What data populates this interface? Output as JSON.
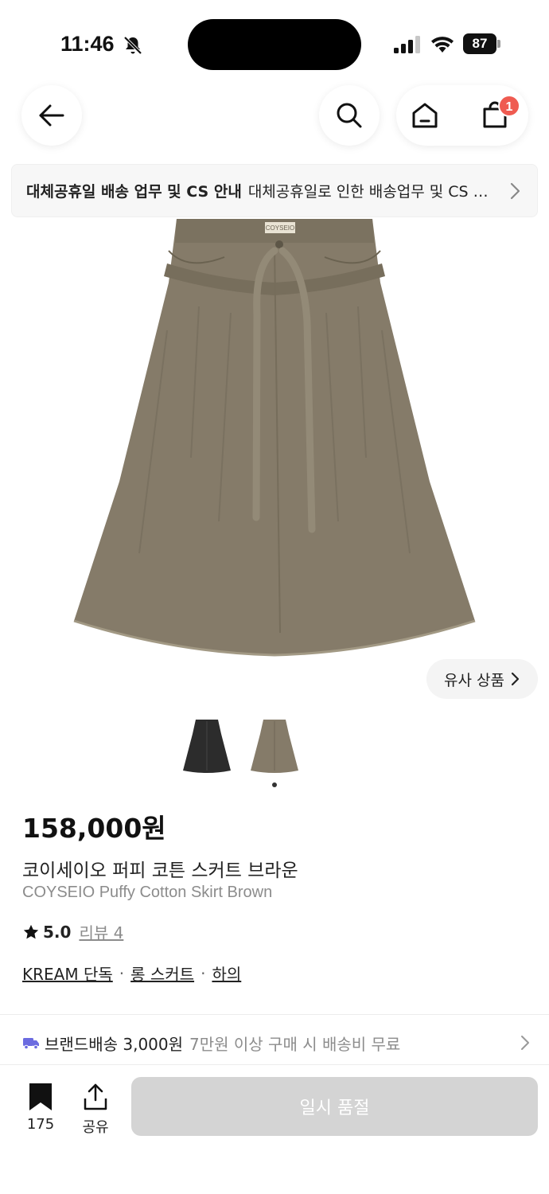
{
  "status_bar": {
    "time": "11:46",
    "battery": "87"
  },
  "notice": {
    "title": "대체공휴일 배송 업무 및 CS 안내",
    "text": "대체공휴일로 인한 배송업무 및 CS 운영 안내"
  },
  "nav": {
    "cart_count": "1"
  },
  "gallery": {
    "similar_label": "유사 상품",
    "thumbnails": [
      "black-skirt",
      "brown-skirt"
    ]
  },
  "product": {
    "price": "158,000원",
    "name_ko": "코이세이오 퍼피 코튼 스커트 브라운",
    "name_en": "COYSEIO Puffy Cotton Skirt Brown",
    "rating": "5.0",
    "review_label": "리뷰 4",
    "tags": [
      "KREAM 단독",
      "롱 스커트",
      "하의"
    ],
    "label_tag": "COYSEIO",
    "color": "#857b69"
  },
  "shipping": {
    "label": "브랜드배송 3,000원",
    "note": "7만원 이상 구매 시 배송비 무료"
  },
  "bottom": {
    "bookmark_count": "175",
    "share_label": "공유",
    "soldout_label": "일시 품절"
  }
}
